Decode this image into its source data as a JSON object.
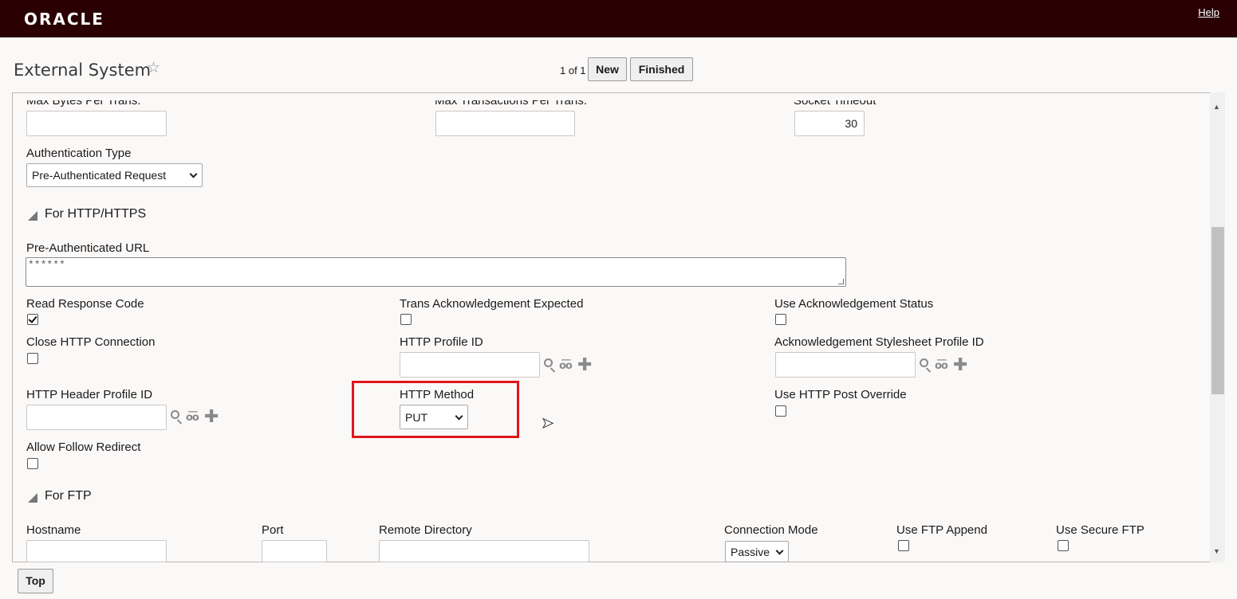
{
  "app": {
    "logo": "ORACLE",
    "help_link": "Help"
  },
  "header": {
    "title": "External System",
    "favorite_icon": "star-icon",
    "record_count": "1 of 1",
    "new_button": "New",
    "finished_button": "Finished"
  },
  "fields": {
    "max_bytes_label": "Max Bytes Per Trans.",
    "max_bytes_value": "",
    "max_trans_label": "Max Transactions Per Trans.",
    "max_trans_value": "",
    "socket_timeout_label": "Socket Timeout",
    "socket_timeout_value": "30",
    "auth_type_label": "Authentication Type",
    "auth_type_value": "Pre-Authenticated Request"
  },
  "http_section": {
    "title": "For HTTP/HTTPS",
    "pre_auth_url_label": "Pre-Authenticated URL",
    "pre_auth_url_value": "******",
    "read_response_code_label": "Read Response Code",
    "read_response_code_checked": true,
    "trans_ack_expected_label": "Trans Acknowledgement Expected",
    "trans_ack_expected_checked": false,
    "use_ack_status_label": "Use Acknowledgement Status",
    "use_ack_status_checked": false,
    "close_http_conn_label": "Close HTTP Connection",
    "close_http_conn_checked": false,
    "http_profile_id_label": "HTTP Profile ID",
    "http_profile_id_value": "",
    "ack_stylesheet_label": "Acknowledgement Stylesheet Profile ID",
    "ack_stylesheet_value": "",
    "http_header_profile_label": "HTTP Header Profile ID",
    "http_header_profile_value": "",
    "http_method_label": "HTTP Method",
    "http_method_value": "PUT",
    "use_http_post_override_label": "Use HTTP Post Override",
    "use_http_post_override_checked": false,
    "allow_follow_redirect_label": "Allow Follow Redirect",
    "allow_follow_redirect_checked": false
  },
  "ftp_section": {
    "title": "For FTP",
    "hostname_label": "Hostname",
    "hostname_value": "",
    "port_label": "Port",
    "port_value": "",
    "remote_dir_label": "Remote Directory",
    "remote_dir_value": "",
    "connection_mode_label": "Connection Mode",
    "connection_mode_value": "Passive",
    "use_ftp_append_label": "Use FTP Append",
    "use_ftp_append_checked": false,
    "use_secure_ftp_label": "Use Secure FTP",
    "use_secure_ftp_checked": false
  },
  "footer": {
    "top_button": "Top"
  },
  "colors": {
    "topbar": "#2a0002",
    "highlight": "#e0161c"
  }
}
